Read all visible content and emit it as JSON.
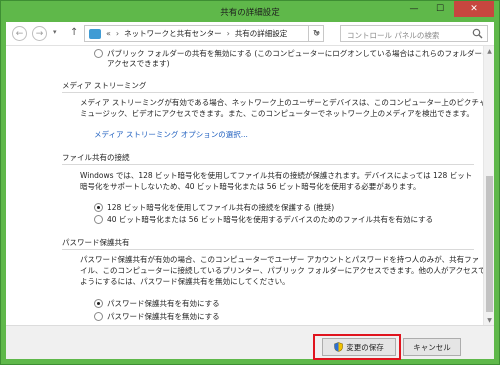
{
  "window": {
    "title": "共有の詳細設定",
    "controls": {
      "minimize": "—",
      "maximize": "☐",
      "close": "✕"
    }
  },
  "navbar": {
    "back": "←",
    "forward": "→",
    "up": "↑",
    "address": [
      "ネットワークと共有センター",
      "共有の詳細設定"
    ],
    "address_prefix": "«",
    "separator": "›",
    "search_placeholder": "コントロール パネルの検索"
  },
  "content": {
    "top_option": {
      "line1": "パブリック フォルダーの共有を無効にする (このコンピューターにログオンしている場合はこれらのフォルダーに",
      "line2": "アクセスできます)"
    },
    "media": {
      "title": "メディア ストリーミング",
      "desc1": "メディア ストリーミングが有効である場合、ネットワーク上のユーザーとデバイスは、このコンピューター上のピクチャ、",
      "desc2": "ミュージック、ビデオにアクセスできます。また、このコンピューターでネットワーク上のメディアを検出できます。",
      "link": "メディア ストリーミング オプションの選択..."
    },
    "file_sharing": {
      "title": "ファイル共有の接続",
      "desc1": "Windows では、128 ビット暗号化を使用してファイル共有の接続が保護されます。デバイスによっては 128 ビット",
      "desc2": "暗号化をサポートしないため、40 ビット暗号化または 56 ビット暗号化を使用する必要があります。",
      "option1": "128 ビット暗号化を使用してファイル共有の接続を保護する (推奨)",
      "option2": "40 ビット暗号化または 56 ビット暗号化を使用するデバイスのためのファイル共有を有効にする"
    },
    "password": {
      "title": "パスワード保護共有",
      "desc1": "パスワード保護共有が有効の場合、このコンピューターでユーザー アカウントとパスワードを持つ人のみが、共有ファ",
      "desc2": "イル、このコンピューターに接続しているプリンター、パブリック フォルダーにアクセスできます。他の人がアクセスできる",
      "desc3": "ようにするには、パスワード保護共有を無効にしてください。",
      "option1": "パスワード保護共有を有効にする",
      "option2": "パスワード保護共有を無効にする"
    }
  },
  "footer": {
    "save_label": "変更の保存",
    "cancel_label": "キャンセル"
  },
  "colors": {
    "frame": "#5fb84a",
    "close_button": "#c7463f",
    "link": "#1f5fbf",
    "highlight": "#e0141e"
  }
}
